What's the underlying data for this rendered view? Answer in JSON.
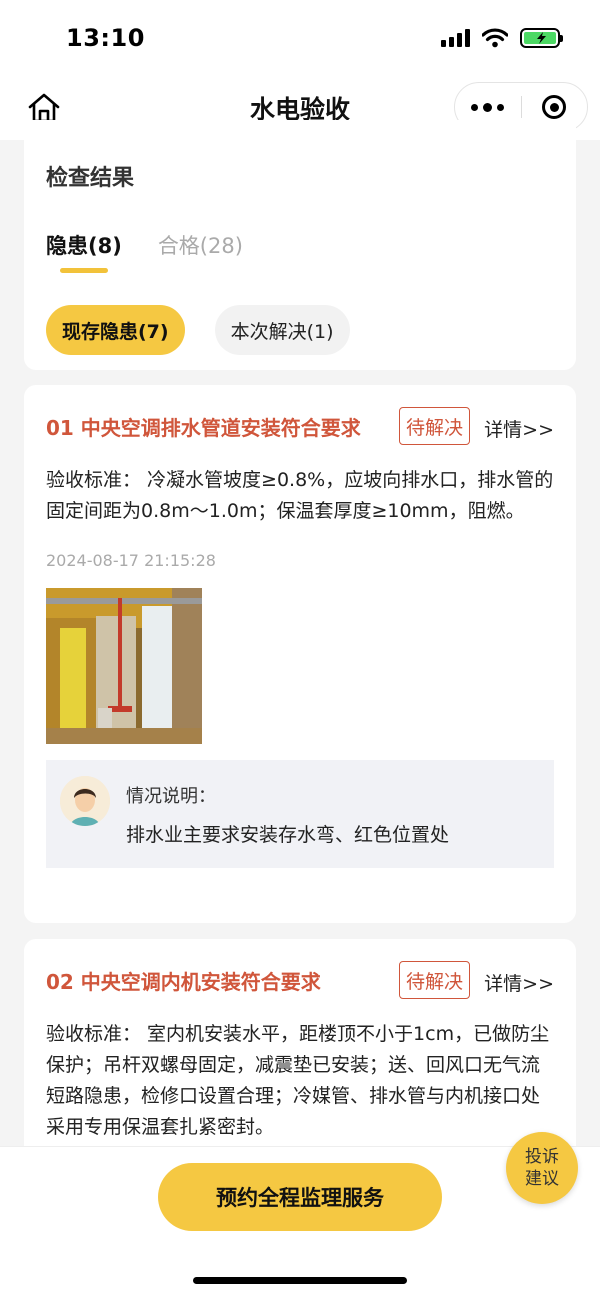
{
  "status_bar": {
    "time": "13:10"
  },
  "nav": {
    "title": "水电验收"
  },
  "result": {
    "section_title": "检查结果",
    "tabs": [
      {
        "label": "隐患(8)",
        "active": true
      },
      {
        "label": "合格(28)",
        "active": false
      }
    ],
    "filters": [
      {
        "label": "现存隐患(7)",
        "active": true
      },
      {
        "label": "本次解决(1)",
        "active": false
      }
    ]
  },
  "issues": [
    {
      "title": "01 中央空调排水管道安装符合要求",
      "status": "待解决",
      "detail_label": "详情>>",
      "standard": "验收标准：  冷凝水管坡度≥0.8%，应坡向排水口，排水管的固定间距为0.8m～1.0m；保温套厚度≥10mm，阻燃。",
      "time": "2024-08-17 21:15:28",
      "note_label": "情况说明：",
      "note_text": "排水业主要求安装存水弯、红色位置处"
    },
    {
      "title": "02 中央空调内机安装符合要求",
      "status": "待解决",
      "detail_label": "详情>>",
      "standard": "验收标准：  室内机安装水平，距楼顶不小于1cm，已做防尘保护；吊杆双螺母固定，减震垫已安装；送、回风口无气流短路隐患，检修口设置合理；冷媒管、排水管与内机接口处采用专用保温套扎紧密封。"
    }
  ],
  "bottom": {
    "cta_label": "预约全程监理服务",
    "fab_line1": "投诉",
    "fab_line2": "建议"
  },
  "colors": {
    "accent_yellow": "#f5c842",
    "issue_red": "#d0563b",
    "page_bg": "#f4f4f4"
  }
}
